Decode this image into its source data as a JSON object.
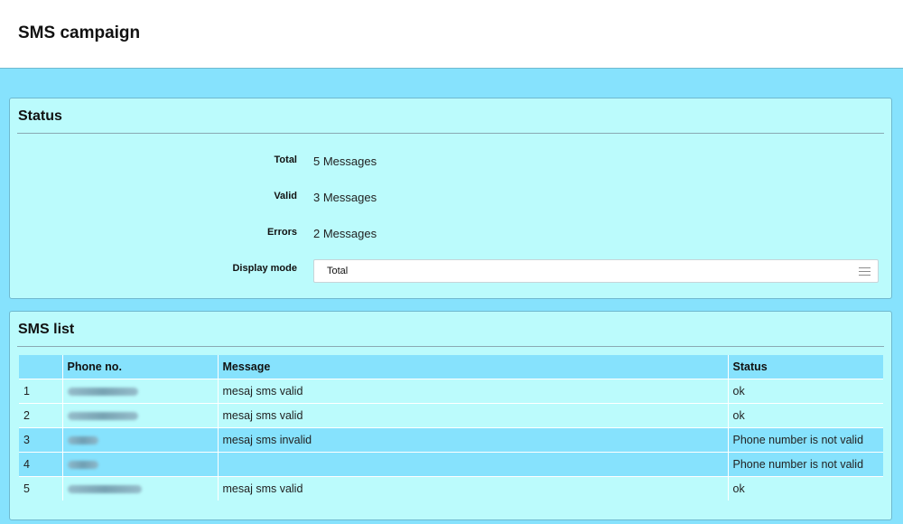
{
  "page": {
    "title": "SMS campaign"
  },
  "status_panel": {
    "title": "Status",
    "rows": [
      {
        "label": "Total",
        "value": "5 Messages"
      },
      {
        "label": "Valid",
        "value": "3 Messages"
      },
      {
        "label": "Errors",
        "value": "2 Messages"
      }
    ],
    "display_mode": {
      "label": "Display mode",
      "selected": "Total"
    }
  },
  "sms_panel": {
    "title": "SMS list",
    "columns": [
      "",
      "Phone no.",
      "Message",
      "Status"
    ],
    "rows": [
      {
        "index": "1",
        "phone_redacted": true,
        "message": "mesaj sms valid",
        "status": "ok",
        "error": false
      },
      {
        "index": "2",
        "phone_redacted": true,
        "message": "mesaj sms valid",
        "status": "ok",
        "error": false
      },
      {
        "index": "3",
        "phone_redacted": true,
        "message": "mesaj sms invalid",
        "status": "Phone number is not valid",
        "error": true
      },
      {
        "index": "4",
        "phone_redacted": true,
        "message": "",
        "status": "Phone number is not valid",
        "error": true
      },
      {
        "index": "5",
        "phone_redacted": true,
        "message": "mesaj sms valid",
        "status": "ok",
        "error": false
      }
    ]
  },
  "colors": {
    "background": "#86e2fd",
    "panel": "#bbfbfc",
    "header_row": "#86e2fd"
  },
  "icons": {
    "select_toggle": "menu-lines-icon"
  }
}
